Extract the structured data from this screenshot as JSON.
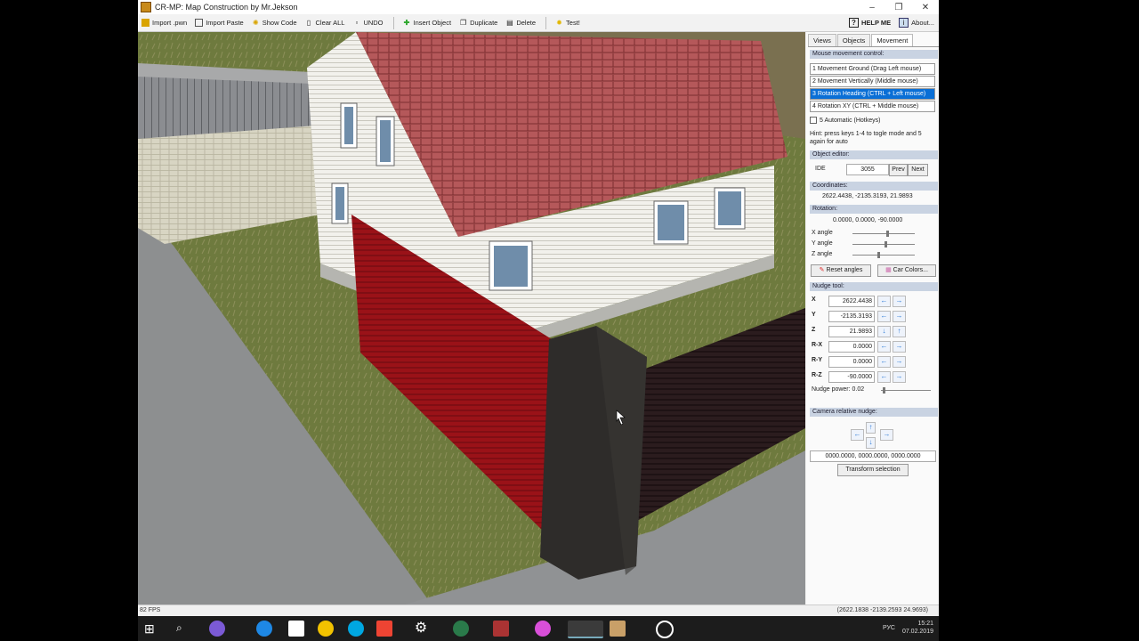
{
  "window": {
    "title": "CR-MP: Map Construction by Mr.Jekson",
    "min": "–",
    "max": "❐",
    "close": "✕"
  },
  "toolbar": {
    "items": [
      {
        "label": "Import .pwn",
        "icon": "import-icon",
        "color": "#d9a400"
      },
      {
        "label": "Import Paste",
        "icon": "paste-icon",
        "color": "#555"
      },
      {
        "label": "Show Code",
        "icon": "code-icon",
        "color": "#d9a400"
      },
      {
        "label": "Clear ALL",
        "icon": "clear-icon",
        "color": "#555"
      },
      {
        "label": "UNDO",
        "icon": "undo-icon",
        "color": "#444"
      },
      {
        "label": "Insert Object",
        "icon": "plus-icon",
        "color": "#2fa82f"
      },
      {
        "label": "Duplicate",
        "icon": "duplicate-icon",
        "color": "#555"
      },
      {
        "label": "Delete",
        "icon": "delete-icon",
        "color": "#555"
      },
      {
        "label": "Test!",
        "icon": "sun-icon",
        "color": "#e2b700"
      }
    ],
    "help": "HELP ME",
    "about": "About..."
  },
  "panel": {
    "tabs": [
      "Views",
      "Objects",
      "Movement"
    ],
    "mouse_header": "Mouse movement control:",
    "modes": [
      "1 Movement Ground (Drag Left mouse)",
      "2 Movement Vertically (Middle mouse)",
      "3 Rotation Heading (CTRL + Left mouse)",
      "4 Rotation XY (CTRL + Middle mouse)"
    ],
    "auto": "5 Automatic (Hotkeys)",
    "hint": "Hint: press keys 1-4 to togle mode and 5 again for auto",
    "object_editor": "Object editor:",
    "ide_label": "IDE",
    "ide_value": "3055",
    "prev": "Prev",
    "next": "Next",
    "coords_header": "Coordinates:",
    "coords": "2622.4438, -2135.3193, 21.9893",
    "rot_header": "Rotation:",
    "rot": "0.0000, 0.0000, -90.0000",
    "x_angle": "X angle",
    "y_angle": "Y angle",
    "z_angle": "Z angle",
    "reset": "Reset angles",
    "car_colors": "Car Colors...",
    "nudge_header": "Nudge tool:",
    "nudge": [
      {
        "axis": "X",
        "value": "2622.4438"
      },
      {
        "axis": "Y",
        "value": "-2135.3193"
      },
      {
        "axis": "Z",
        "value": "21.9893"
      },
      {
        "axis": "R-X",
        "value": "0.0000"
      },
      {
        "axis": "R-Y",
        "value": "0.0000"
      },
      {
        "axis": "R-Z",
        "value": "-90.0000"
      }
    ],
    "nudge_power": "Nudge power: 0.02",
    "cam_header": "Camera relative nudge:",
    "cam_value": "0000.0000, 0000.0000, 0000.0000",
    "transform": "Transform selection"
  },
  "status": {
    "fps": "82 FPS",
    "coords": "(2622.1838 -2139.2593 24.9693)"
  },
  "tray": {
    "lang": "РУС",
    "time": "15:21",
    "date": "07.02.2019"
  }
}
